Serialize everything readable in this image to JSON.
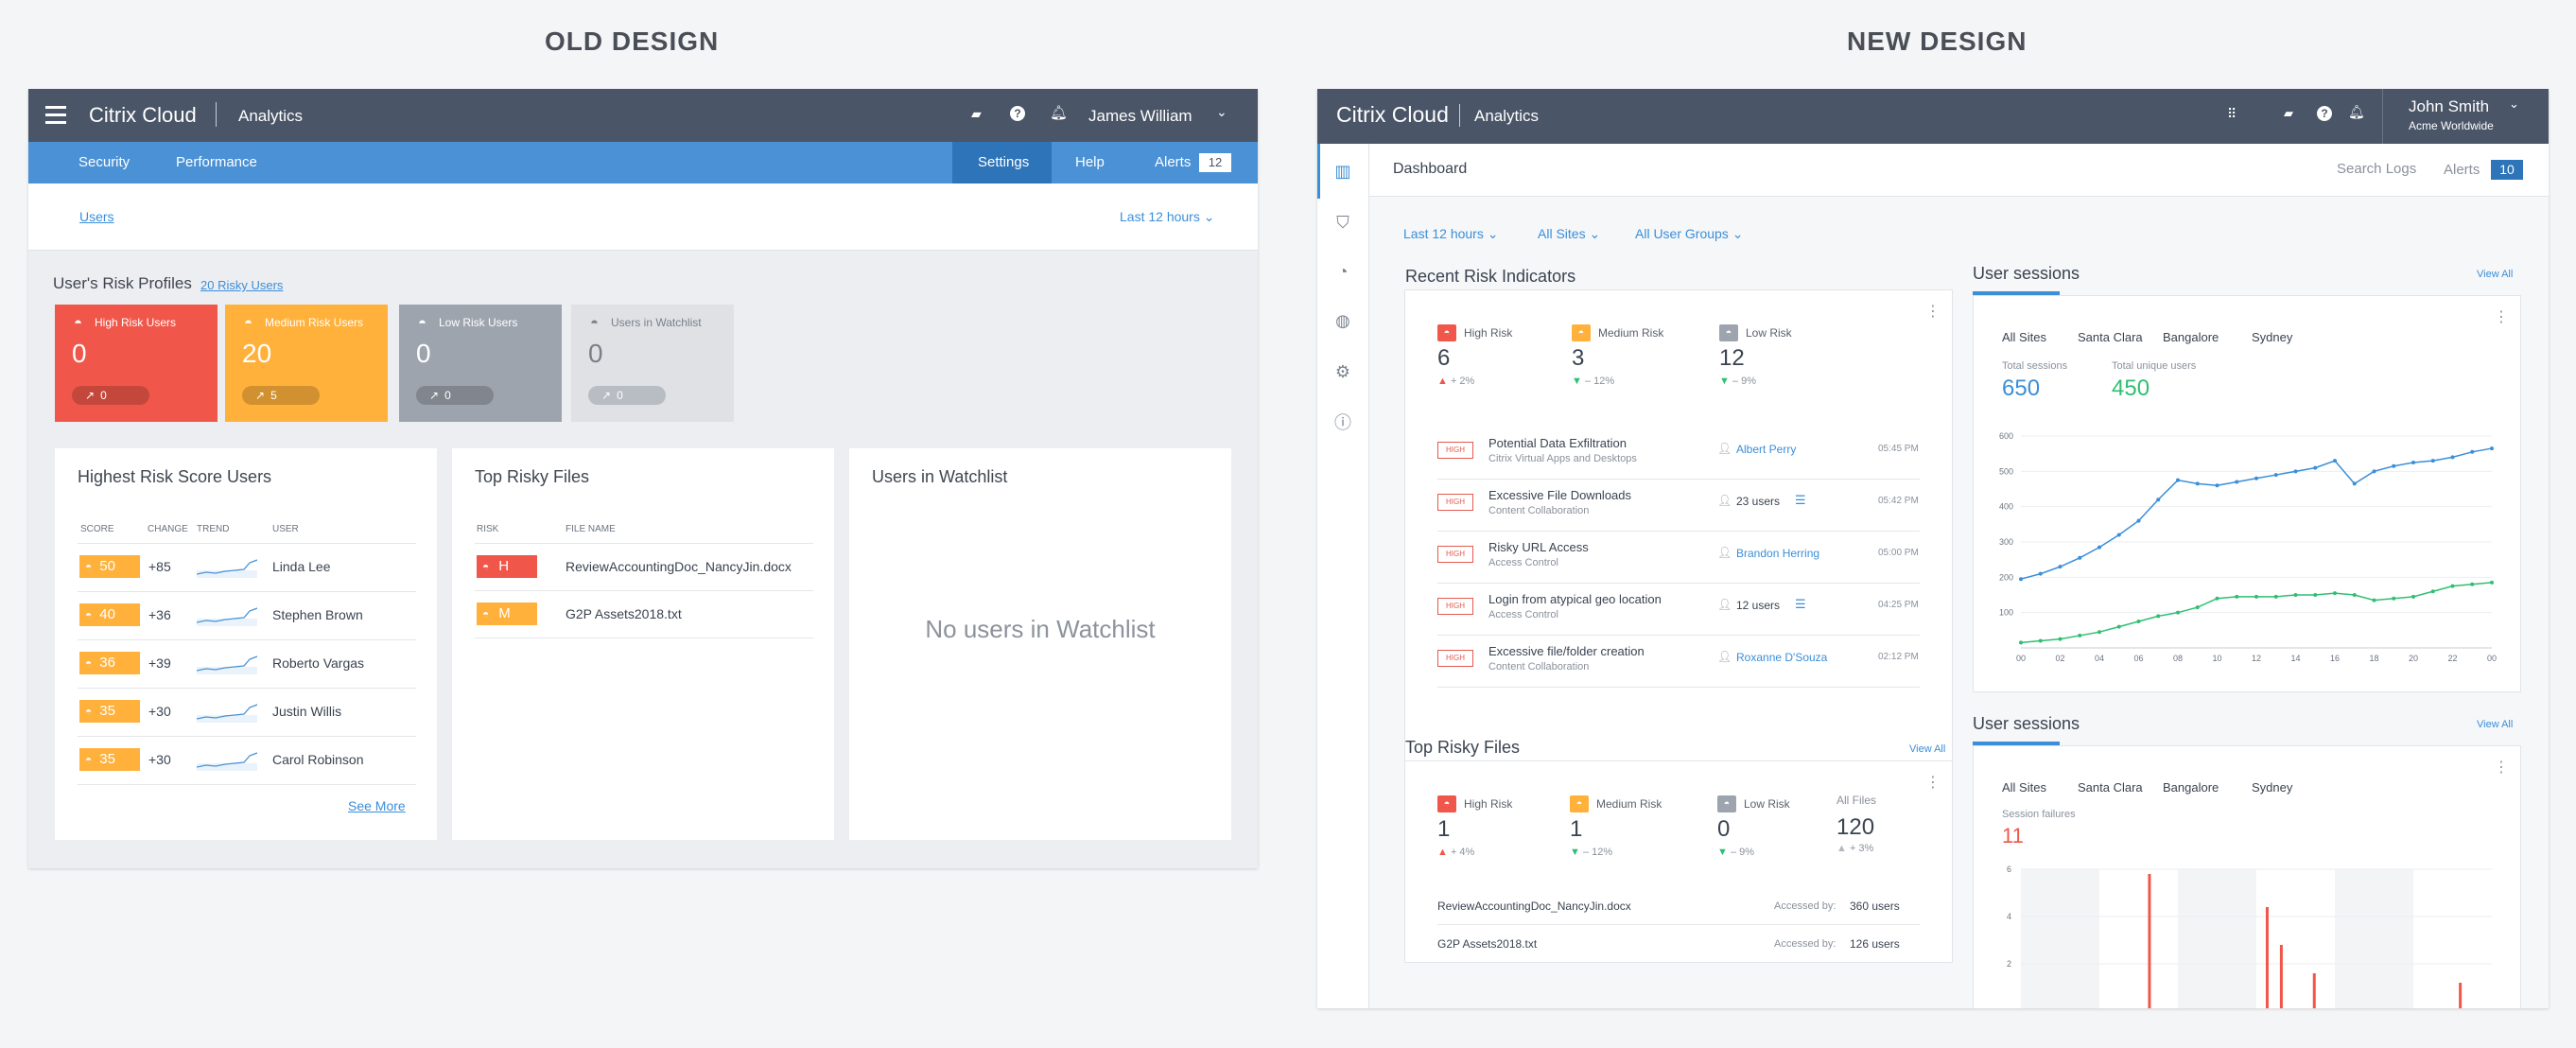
{
  "headings": {
    "old": "OLD DESIGN",
    "new": "NEW DESIGN"
  },
  "old": {
    "brand": "Citrix",
    "brand_suffix": "Cloud",
    "product": "Analytics",
    "user": "James William",
    "nav": [
      "Security",
      "Performance"
    ],
    "nav_right": [
      "Settings",
      "Help",
      "Alerts"
    ],
    "alerts_count": "12",
    "users_link": "Users",
    "time_filter": "Last 12 hours",
    "risk_profiles_title": "User's Risk Profiles",
    "risky_users_link": "20 Risky Users",
    "tiles": [
      {
        "label": "High Risk Users",
        "value": "0",
        "change": "0",
        "color": "#f0574a"
      },
      {
        "label": "Medium Risk Users",
        "value": "20",
        "change": "5",
        "color": "#ffb13b"
      },
      {
        "label": "Low Risk Users",
        "value": "0",
        "change": "0",
        "color": "#9ea4ae"
      },
      {
        "label": "Users in Watchlist",
        "value": "0",
        "change": "0",
        "color": "#dfe1e5"
      }
    ],
    "highest_risk": {
      "title": "Highest Risk Score Users",
      "headers": [
        "SCORE",
        "CHANGE",
        "TREND",
        "USER"
      ],
      "rows": [
        {
          "score": "50",
          "change": "+85",
          "user": "Linda Lee"
        },
        {
          "score": "40",
          "change": "+36",
          "user": "Stephen Brown"
        },
        {
          "score": "36",
          "change": "+39",
          "user": "Roberto Vargas"
        },
        {
          "score": "35",
          "change": "+30",
          "user": "Justin Willis"
        },
        {
          "score": "35",
          "change": "+30",
          "user": "Carol Robinson"
        }
      ],
      "see_more": "See More"
    },
    "top_risky_files": {
      "title": "Top Risky Files",
      "headers": [
        "RISK",
        "FILE NAME"
      ],
      "rows": [
        {
          "risk": "H",
          "file": "ReviewAccountingDoc_NancyJin.docx",
          "color": "#f0574a"
        },
        {
          "risk": "M",
          "file": "G2P Assets2018.txt",
          "color": "#ffb13b"
        }
      ]
    },
    "watchlist": {
      "title": "Users in Watchlist",
      "empty": "No users in Watchlist"
    }
  },
  "new": {
    "brand": "Citrix",
    "brand_suffix": "Cloud",
    "product": "Analytics",
    "user": "John Smith",
    "org": "Acme Worldwide",
    "page": "Dashboard",
    "search_logs": "Search Logs",
    "alerts": "Alerts",
    "alerts_count": "10",
    "filters": [
      "Last 12 hours",
      "All Sites",
      "All User Groups"
    ],
    "recent_risk": {
      "title": "Recent Risk Indicators",
      "kpis": [
        {
          "label": "High Risk",
          "value": "6",
          "delta": "+ 2%",
          "dir": "up",
          "color": "#f0574a"
        },
        {
          "label": "Medium Risk",
          "value": "3",
          "delta": "– 12%",
          "dir": "down",
          "color": "#ffb13b"
        },
        {
          "label": "Low Risk",
          "value": "12",
          "delta": "– 9%",
          "dir": "down",
          "color": "#9ea4ae"
        }
      ],
      "severity": "HIGH",
      "rows": [
        {
          "title": "Potential Data Exfiltration",
          "sub": "Citrix Virtual Apps and Desktops",
          "who": "Albert Perry",
          "time": "05:45 PM",
          "link": true
        },
        {
          "title": "Excessive File Downloads",
          "sub": "Content Collaboration",
          "who": "23 users",
          "time": "05:42 PM",
          "link": false
        },
        {
          "title": "Risky URL Access",
          "sub": "Access Control",
          "who": "Brandon Herring",
          "time": "05:00 PM",
          "link": true
        },
        {
          "title": "Login from atypical geo location",
          "sub": "Access Control",
          "who": "12 users",
          "time": "04:25 PM",
          "link": false
        },
        {
          "title": "Excessive file/folder creation",
          "sub": "Content Collaboration",
          "who": "Roxanne D'Souza",
          "time": "02:12 PM",
          "link": true
        }
      ]
    },
    "top_files": {
      "title": "Top Risky Files",
      "view_all": "View All",
      "kpis": [
        {
          "label": "High Risk",
          "value": "1",
          "delta": "+ 4%",
          "dir": "up",
          "color": "#f0574a"
        },
        {
          "label": "Medium Risk",
          "value": "1",
          "delta": "– 12%",
          "dir": "down",
          "color": "#ffb13b"
        },
        {
          "label": "Low Risk",
          "value": "0",
          "delta": "– 9%",
          "dir": "down",
          "color": "#9ea4ae"
        }
      ],
      "all_files_label": "All Files",
      "all_files_value": "120",
      "all_files_delta": "+ 3%",
      "rows": [
        {
          "file": "ReviewAccountingDoc_NancyJin.docx",
          "label": "Accessed by:",
          "count": "360 users"
        },
        {
          "file": "G2P Assets2018.txt",
          "label": "Accessed by:",
          "count": "126 users"
        }
      ]
    },
    "sessions1": {
      "title": "User sessions",
      "view_all": "View All",
      "tabs": [
        "All Sites",
        "Santa Clara",
        "Bangalore",
        "Sydney"
      ],
      "total_label": "Total sessions",
      "total_value": "650",
      "unique_label": "Total unique users",
      "unique_value": "450"
    },
    "sessions2": {
      "title": "User sessions",
      "view_all": "View All",
      "tabs": [
        "All Sites",
        "Santa Clara",
        "Bangalore",
        "Sydney"
      ],
      "failures_label": "Session failures",
      "failures_value": "11"
    },
    "colors": {
      "accent": "#3b8ed8",
      "green": "#2fbf71",
      "red": "#f0574a"
    }
  },
  "chart_data": [
    {
      "type": "line",
      "x": [
        "00",
        "01",
        "02",
        "03",
        "04",
        "05",
        "06",
        "07",
        "08",
        "09",
        "10",
        "11",
        "12",
        "13",
        "14",
        "15",
        "16",
        "17",
        "18",
        "19",
        "20",
        "21",
        "22",
        "23",
        "00"
      ],
      "xticks": [
        "00",
        "02",
        "04",
        "06",
        "08",
        "10",
        "12",
        "14",
        "16",
        "18",
        "20",
        "22",
        "00"
      ],
      "yticks": [
        100,
        200,
        300,
        400,
        500,
        600
      ],
      "ylim": [
        0,
        600
      ],
      "series": [
        {
          "values": [
            195,
            210,
            230,
            255,
            285,
            320,
            360,
            420,
            475,
            465,
            460,
            470,
            480,
            490,
            500,
            510,
            530,
            465,
            500,
            515,
            525,
            530,
            540,
            555,
            565
          ],
          "color": "#3b8ed8"
        },
        {
          "values": [
            15,
            20,
            25,
            35,
            45,
            60,
            75,
            90,
            100,
            115,
            140,
            145,
            145,
            145,
            150,
            150,
            155,
            150,
            135,
            140,
            145,
            160,
            175,
            180,
            185
          ],
          "color": "#2fbf71"
        }
      ]
    },
    {
      "type": "bar",
      "yticks": [
        2,
        4,
        6
      ],
      "ylim": [
        0,
        6
      ],
      "values": [
        5.8,
        4.4,
        2.8,
        1.6,
        1.2
      ],
      "positions": [
        0.27,
        0.52,
        0.55,
        0.62,
        0.93
      ],
      "color": "#f0574a"
    }
  ]
}
